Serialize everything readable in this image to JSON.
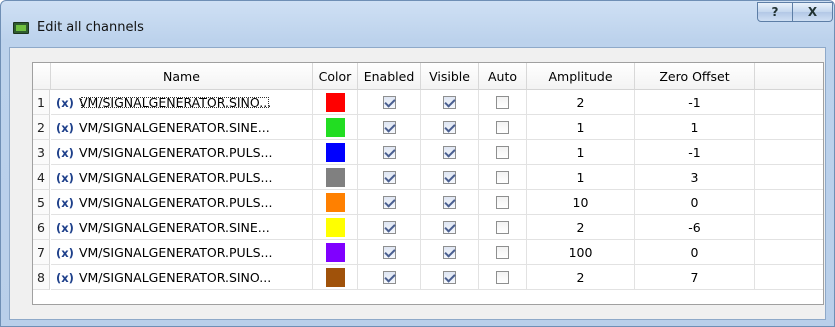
{
  "window": {
    "title": "Edit all channels",
    "help_label": "?",
    "close_label": "X"
  },
  "table": {
    "headers": [
      "Name",
      "Color",
      "Enabled",
      "Visible",
      "Auto",
      "Amplitude",
      "Zero Offset"
    ],
    "rows": [
      {
        "num": "1",
        "icon": "(x)",
        "name": "VM/SIGNALGENERATOR.SINO...",
        "color": "#ff0000",
        "enabled": true,
        "visible": true,
        "auto": false,
        "amplitude": "2",
        "zero_offset": "-1"
      },
      {
        "num": "2",
        "icon": "(x)",
        "name": "VM/SIGNALGENERATOR.SINE...",
        "color": "#22dd22",
        "enabled": true,
        "visible": true,
        "auto": false,
        "amplitude": "1",
        "zero_offset": "1"
      },
      {
        "num": "3",
        "icon": "(x)",
        "name": "VM/SIGNALGENERATOR.PULS...",
        "color": "#0000ff",
        "enabled": true,
        "visible": true,
        "auto": false,
        "amplitude": "1",
        "zero_offset": "-1"
      },
      {
        "num": "4",
        "icon": "(x)",
        "name": "VM/SIGNALGENERATOR.PULS...",
        "color": "#808080",
        "enabled": true,
        "visible": true,
        "auto": false,
        "amplitude": "1",
        "zero_offset": "3"
      },
      {
        "num": "5",
        "icon": "(x)",
        "name": "VM/SIGNALGENERATOR.PULS...",
        "color": "#ff8000",
        "enabled": true,
        "visible": true,
        "auto": false,
        "amplitude": "10",
        "zero_offset": "0"
      },
      {
        "num": "6",
        "icon": "(x)",
        "name": "VM/SIGNALGENERATOR.SINE...",
        "color": "#ffff00",
        "enabled": true,
        "visible": true,
        "auto": false,
        "amplitude": "2",
        "zero_offset": "-6"
      },
      {
        "num": "7",
        "icon": "(x)",
        "name": "VM/SIGNALGENERATOR.PULS...",
        "color": "#8000ff",
        "enabled": true,
        "visible": true,
        "auto": false,
        "amplitude": "100",
        "zero_offset": "0"
      },
      {
        "num": "8",
        "icon": "(x)",
        "name": "VM/SIGNALGENERATOR.SINO...",
        "color": "#a0520a",
        "enabled": true,
        "visible": true,
        "auto": false,
        "amplitude": "2",
        "zero_offset": "7"
      }
    ]
  }
}
